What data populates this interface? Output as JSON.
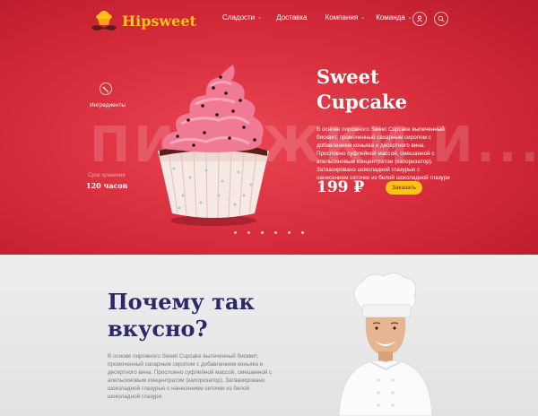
{
  "brand": {
    "name": "Hipsweet"
  },
  "nav": {
    "items": [
      {
        "label": "Сладости",
        "dropdown": true
      },
      {
        "label": "Доставка",
        "dropdown": false
      },
      {
        "label": "Компания",
        "dropdown": true
      },
      {
        "label": "Команда",
        "dropdown": true
      }
    ],
    "user_icon": "user-icon",
    "search_icon": "search-icon"
  },
  "hero": {
    "watermark": "ПИРОЖКИ И...",
    "ingredients_label": "Ингредиенты",
    "time_label": "Срок хранения",
    "time_value": "120 часов",
    "title_line1": "Sweet",
    "title_line2": "Cupcake",
    "description": "В основе пирожного Sweet Cupcake выпеченный бисквит, промоченный сахарным сиропом с добавлением коньяка и десертного вина. Прослоено суфлейной массой, смешанной с апельсиновым концентратом (капоризатор). Затвазировано шоколадной глазурью с нанесением сеточки из белой шоколадной глазури",
    "price": "199 ₽",
    "order_button": "Заказать",
    "slides": 6
  },
  "why": {
    "title_line1": "Почему так",
    "title_line2": "вкусно?",
    "text": "В основе пирожного Sweet Cupcake выпеченный бисквит, промоченный сахарным сиропом с добавлением коньяка и десертного вина. Прослоено суфлейной массой, смешанной с апельсиновым концентратом (капоризатор). Затвазировано шоколадной глазурью с нанесением сеточки из белой шоколадной глазури"
  },
  "colors": {
    "hero_red": "#d52a3a",
    "accent_yellow": "#ffc21a",
    "heading_navy": "#2a2a6a"
  }
}
